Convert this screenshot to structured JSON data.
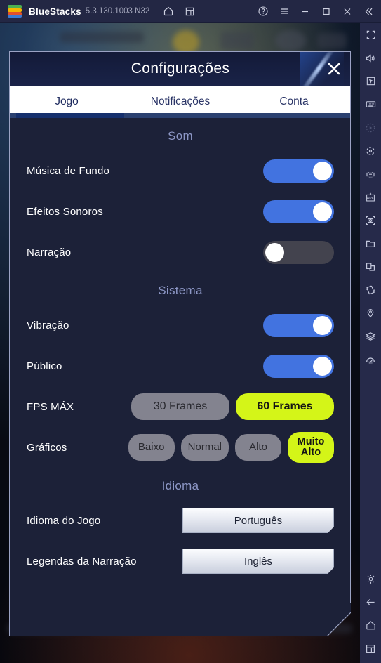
{
  "titlebar": {
    "app_name": "BlueStacks",
    "version": "5.3.130.1003 N32",
    "left_icons": [
      {
        "name": "home-icon"
      },
      {
        "name": "multi-instance-icon"
      }
    ],
    "right_icons": [
      {
        "name": "help-icon"
      },
      {
        "name": "menu-icon"
      },
      {
        "name": "minimize-icon"
      },
      {
        "name": "maximize-icon"
      },
      {
        "name": "close-icon"
      },
      {
        "name": "collapse-sidebar-icon"
      }
    ]
  },
  "sidebar": {
    "icons": [
      {
        "name": "fullscreen-icon",
        "dim": false
      },
      {
        "name": "volume-icon",
        "dim": false
      },
      {
        "name": "game-controls-icon",
        "dim": false
      },
      {
        "name": "keyboard-icon",
        "dim": false
      },
      {
        "name": "macro-play-icon",
        "dim": true
      },
      {
        "name": "rotate-icon",
        "dim": false
      },
      {
        "name": "multi-instance-manager-icon",
        "dim": false
      },
      {
        "name": "install-apk-icon",
        "dim": false
      },
      {
        "name": "screenshot-icon",
        "dim": false
      },
      {
        "name": "media-manager-icon",
        "dim": false
      },
      {
        "name": "copy-paste-icon",
        "dim": false
      },
      {
        "name": "shake-icon",
        "dim": false
      },
      {
        "name": "location-icon",
        "dim": false
      },
      {
        "name": "layers-icon",
        "dim": false
      },
      {
        "name": "performance-icon",
        "dim": false
      }
    ],
    "bottom_icons": [
      {
        "name": "settings-gear-icon"
      },
      {
        "name": "back-arrow-icon"
      },
      {
        "name": "home-icon"
      },
      {
        "name": "recent-apps-icon"
      }
    ]
  },
  "dialog": {
    "title": "Configurações",
    "close_label": "×",
    "tabs": [
      {
        "label": "Jogo",
        "active": true
      },
      {
        "label": "Notificações",
        "active": false
      },
      {
        "label": "Conta",
        "active": false
      }
    ],
    "sections": [
      {
        "title": "Som",
        "rows": [
          {
            "label": "Música de Fundo",
            "type": "toggle",
            "state": "on"
          },
          {
            "label": "Efeitos Sonoros",
            "type": "toggle",
            "state": "on"
          },
          {
            "label": "Narração",
            "type": "toggle",
            "state": "off"
          }
        ]
      },
      {
        "title": "Sistema",
        "rows": [
          {
            "label": "Vibração",
            "type": "toggle",
            "state": "on"
          },
          {
            "label": "Público",
            "type": "toggle",
            "state": "on"
          },
          {
            "label": "FPS MÁX",
            "type": "pills",
            "options": [
              "30 Frames",
              "60 Frames"
            ],
            "selected": "60 Frames"
          },
          {
            "label": "Gráficos",
            "type": "pills",
            "options": [
              "Baixo",
              "Normal",
              "Alto",
              "Muito Alto"
            ],
            "selected": "Muito Alto"
          }
        ]
      },
      {
        "title": "Idioma",
        "rows": [
          {
            "label": "Idioma do Jogo",
            "type": "button",
            "value": "Português"
          },
          {
            "label": "Legendas da Narração",
            "type": "button",
            "value": "Inglês"
          }
        ]
      }
    ]
  },
  "colors": {
    "toggle_on": "#4273e0",
    "toggle_off": "#43434e",
    "selected_pill": "#d4f518",
    "unselected_pill": "#83838f",
    "dialog_bg": "#1c2138",
    "titlebar_bg": "#232744",
    "sidebar_bg": "#262a4a"
  }
}
